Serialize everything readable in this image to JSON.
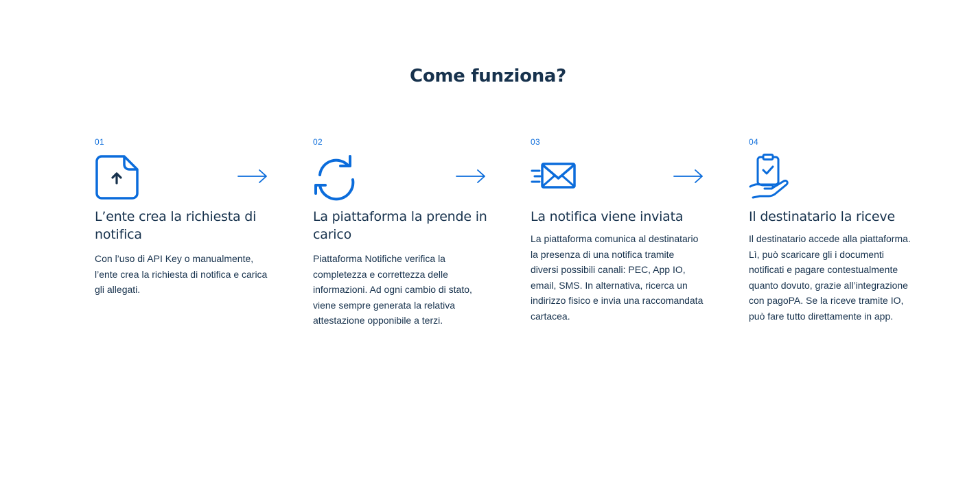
{
  "section": {
    "title": "Come funziona?"
  },
  "colors": {
    "accent": "#0b6cdb",
    "text": "#17324d"
  },
  "steps": [
    {
      "number": "01",
      "icon": "file-upload-icon",
      "title": "L’ente crea la richiesta di notifica",
      "text": "Con l’uso di API Key o manualmente, l’ente crea la richiesta di notifica e carica gli allegati."
    },
    {
      "number": "02",
      "icon": "sync-icon",
      "title": "La piattaforma la prende in carico",
      "text": "Piattaforma Notifiche verifica la completezza e correttezza delle informazioni. Ad ogni cambio di stato, viene sempre generata la relativa attestazione opponibile a terzi."
    },
    {
      "number": "03",
      "icon": "send-mail-icon",
      "title": "La notifica viene inviata",
      "text": "La piattaforma comunica al destinatario la presenza di una notifica tramite diversi possibili canali: PEC, App IO, email, SMS. In alternativa, ricerca un indirizzo fisico e invia una raccomandata cartacea."
    },
    {
      "number": "04",
      "icon": "hand-clipboard-check-icon",
      "title": "Il destinatario la riceve",
      "text": "Il destinatario accede alla piattaforma. Lì, può scaricare gli i documenti notificati e pagare contestualmente quanto dovuto, grazie all’integrazione con pagoPA. Se la riceve tramite IO, può fare tutto direttamente in app."
    }
  ]
}
